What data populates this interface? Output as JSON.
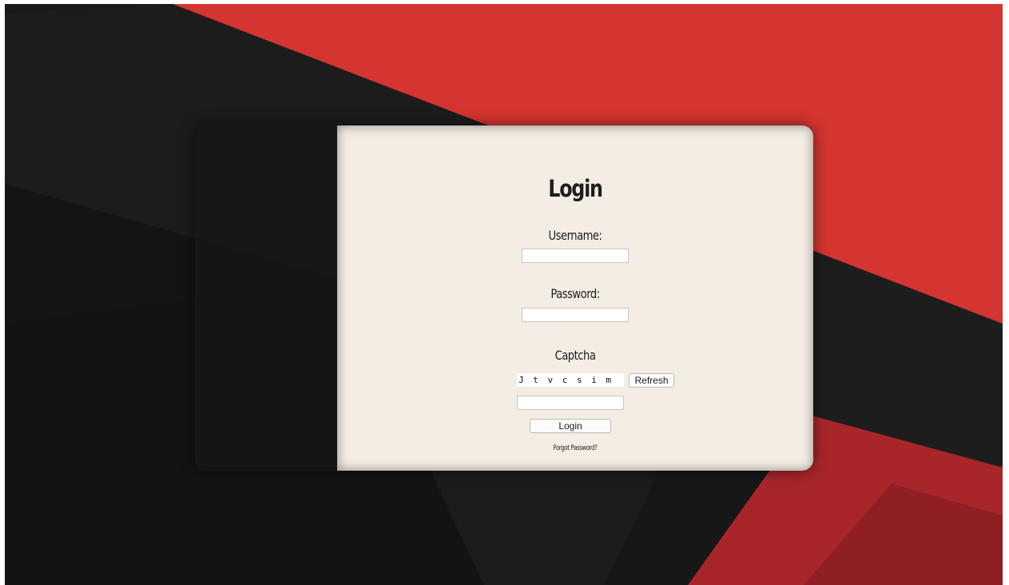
{
  "theme": {
    "background_dark": "#1b1b1b",
    "background_red": "#d43530",
    "panel_color": "#f3ede4"
  },
  "login": {
    "title": "Login",
    "username_label": "Username:",
    "username_value": "",
    "password_label": "Password:",
    "password_value": "",
    "captcha_label": "Captcha",
    "captcha_code": "J t v c s i m",
    "refresh_label": "Refresh",
    "captcha_value": "",
    "login_button_label": "Login",
    "forgot_password_label": "Forgot Password?"
  }
}
